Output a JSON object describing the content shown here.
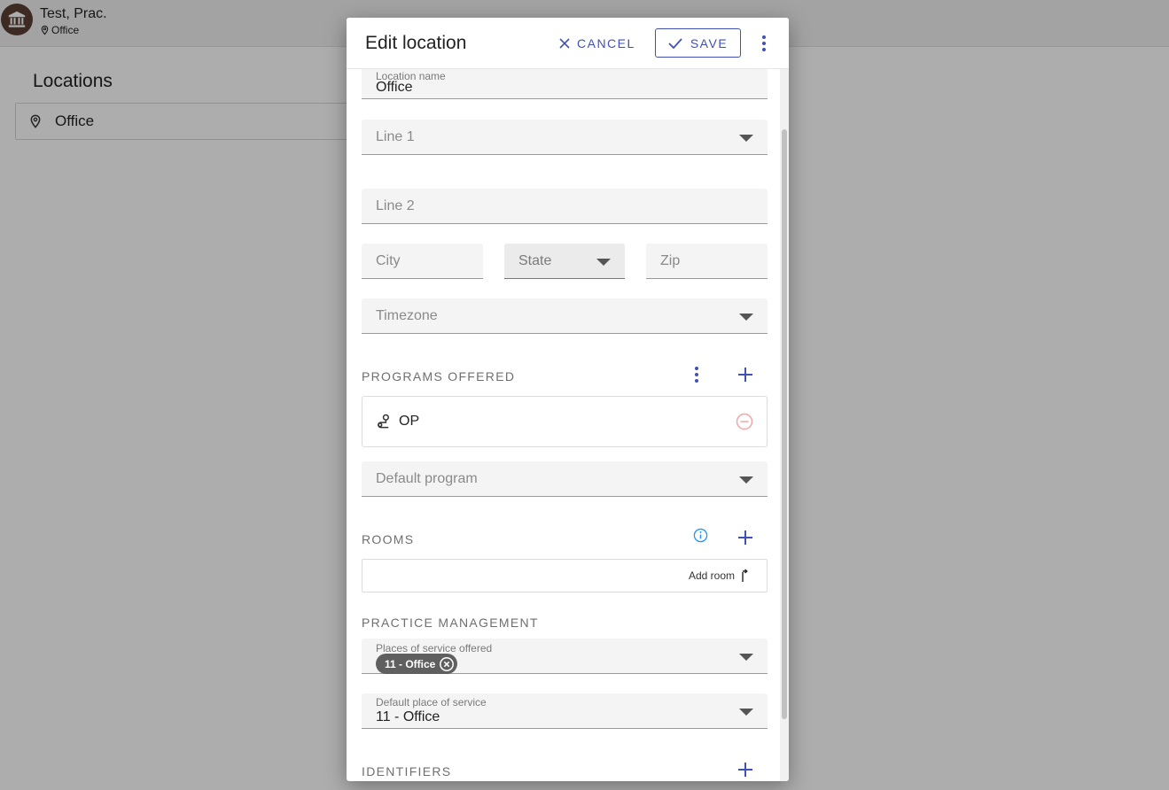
{
  "app": {
    "user_name": "Test, Prac.",
    "user_location": "Office",
    "page_title": "Locations",
    "locations": [
      {
        "label": "Office"
      }
    ]
  },
  "dialog": {
    "title": "Edit location",
    "cancel_label": "CANCEL",
    "save_label": "SAVE",
    "fields": {
      "location_name": {
        "label": "Location name",
        "value": "Office"
      },
      "line1": {
        "placeholder": "Line 1"
      },
      "line2": {
        "placeholder": "Line 2"
      },
      "city": {
        "placeholder": "City"
      },
      "state": {
        "placeholder": "State"
      },
      "zip": {
        "placeholder": "Zip"
      },
      "timezone": {
        "placeholder": "Timezone"
      }
    },
    "programs": {
      "title": "PROGRAMS OFFERED",
      "items": [
        {
          "label": "OP"
        }
      ],
      "default_program_placeholder": "Default program"
    },
    "rooms": {
      "title": "ROOMS",
      "add_room_label": "Add room"
    },
    "practice_management": {
      "title": "PRACTICE MANAGEMENT",
      "places_label": "Places of service offered",
      "places_chips": [
        {
          "label": "11 - Office"
        }
      ],
      "default_place_label": "Default place of service",
      "default_place_value": "11 - Office"
    },
    "identifiers": {
      "title": "IDENTIFIERS"
    }
  },
  "colors": {
    "accent": "#3f51b5",
    "info": "#2196f3",
    "remove_disabled": "#f3a5a5",
    "avatar_bg": "#5a4034",
    "chip_bg": "#5f5f5f"
  }
}
